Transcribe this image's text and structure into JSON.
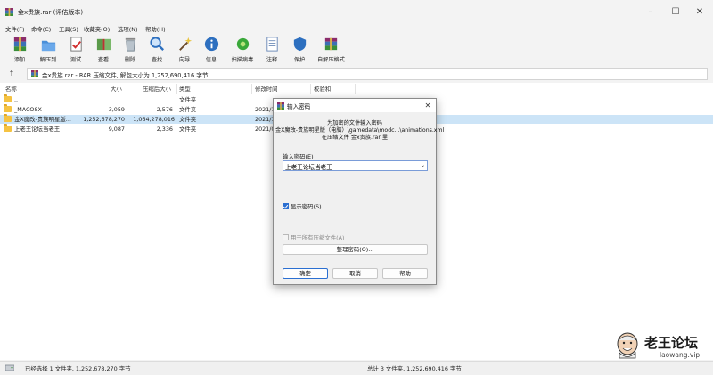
{
  "titlebar": {
    "title": "金x贵族.rar (评估版本)"
  },
  "menu": [
    "文件(F)",
    "命令(C)",
    "工具(S)",
    "收藏夹(O)",
    "选项(N)",
    "帮助(H)"
  ],
  "toolbar": [
    {
      "label": "添加",
      "icon": "add-archive-icon"
    },
    {
      "label": "解压到",
      "icon": "extract-to-icon"
    },
    {
      "label": "测试",
      "icon": "test-icon"
    },
    {
      "label": "查看",
      "icon": "view-icon"
    },
    {
      "label": "删除",
      "icon": "delete-icon"
    },
    {
      "label": "查找",
      "icon": "find-icon"
    },
    {
      "label": "向导",
      "icon": "wizard-icon"
    },
    {
      "label": "信息",
      "icon": "info-icon"
    },
    {
      "label": "扫描病毒",
      "icon": "virus-scan-icon"
    },
    {
      "label": "注释",
      "icon": "comment-icon"
    },
    {
      "label": "保护",
      "icon": "protect-icon"
    },
    {
      "label": "自解压格式",
      "icon": "sfx-icon"
    }
  ],
  "address": {
    "text": "金x贵族.rar - RAR 压缩文件, 解包大小为 1,252,690,416 字节"
  },
  "columns": [
    "名称",
    "大小",
    "压缩后大小",
    "类型",
    "修改时间",
    "校验和"
  ],
  "rows": [
    {
      "name": "..",
      "size": "",
      "packed": "",
      "type": "文件夹",
      "modified": "",
      "crc": ""
    },
    {
      "name": "_MACOSX",
      "size": "3,059",
      "packed": "2,576",
      "type": "文件夹",
      "modified": "2021/1",
      "crc": ""
    },
    {
      "name": "金X魔改-贵族明星版...",
      "size": "1,252,678,270",
      "packed": "1,064,278,016",
      "type": "文件夹",
      "modified": "2021/1",
      "crc": ""
    },
    {
      "name": "上老王论坛当老王",
      "size": "9,087",
      "packed": "2,336",
      "type": "文件夹",
      "modified": "2021/0",
      "crc": ""
    }
  ],
  "status": {
    "left": "已经选择 1 文件夹, 1,252,678,270 字节",
    "right": "总计 3 文件夹, 1,252,690,416 字节"
  },
  "dialog": {
    "title": "输入密码",
    "info_line1": "为加密的文件输入密码",
    "info_line2": "金X魔改-贵族明星版（电脑）\\gamedata\\modc...\\animations.xml",
    "info_line3": "在压缩文件 金x贵族.rar 里",
    "password_label": "输入密码(E)",
    "password_value": "上老王论坛当老王",
    "show_password_label": "显示密码(S)",
    "show_password_checked": true,
    "use_all_label": "用于所有压缩文件(A)",
    "use_all_checked": false,
    "organize_button": "整理密码(O)...",
    "ok_button": "确定",
    "cancel_button": "取消",
    "help_button": "帮助"
  },
  "watermark": {
    "title": "老王论坛",
    "url": "laowang.vip"
  },
  "colors": {
    "selection": "#cce4f7",
    "accent": "#2b6fd1",
    "folder": "#f5c342"
  }
}
